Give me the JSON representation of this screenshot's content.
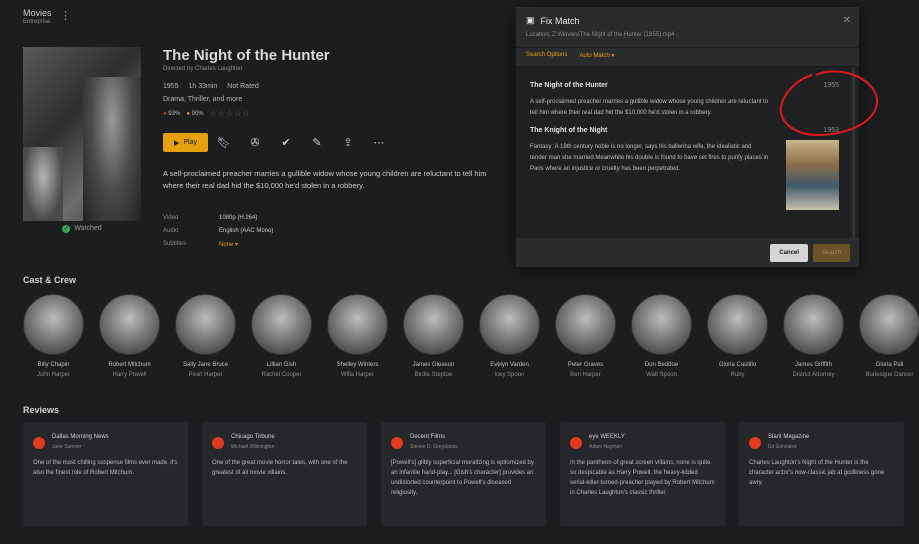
{
  "header": {
    "title": "Movies",
    "subtitle": "Entreprise"
  },
  "movie": {
    "title": "The Night of the Hunter",
    "director": "Directed by Charles Laughton",
    "year": "1955",
    "runtime": "1h 33min",
    "rating": "Not Rated",
    "genres": "Drama, Thriller, and more",
    "critic_score": "93%",
    "audience_score": "90%",
    "play_label": "Play",
    "summary": "A self-proclaimed preacher marries a gullible widow whose young children are reluctant to tell him where their real dad hid the $10,000 he'd stolen in a robbery.",
    "watched_label": "Watched",
    "info": {
      "video_label": "Video",
      "video_value": "1080p (H.264)",
      "audio_label": "Audio",
      "audio_value": "English (AAC Mono)",
      "subtitles_label": "Subtitles",
      "subtitles_value": "None ▾"
    }
  },
  "cast_title": "Cast & Crew",
  "cast": [
    {
      "name": "Billy Chapin",
      "role": "John Harper"
    },
    {
      "name": "Robert Mitchum",
      "role": "Harry Powell"
    },
    {
      "name": "Sally Jane Bruce",
      "role": "Pearl Harper"
    },
    {
      "name": "Lillian Gish",
      "role": "Rachel Cooper"
    },
    {
      "name": "Shelley Winters",
      "role": "Willa Harper"
    },
    {
      "name": "James Gleason",
      "role": "Birdie Steptoe"
    },
    {
      "name": "Evelyn Varden",
      "role": "Icey Spoon"
    },
    {
      "name": "Peter Graves",
      "role": "Ben Harper"
    },
    {
      "name": "Don Beddoe",
      "role": "Walt Spoon"
    },
    {
      "name": "Gloria Castillo",
      "role": "Ruby"
    },
    {
      "name": "James Griffith",
      "role": "District Attorney"
    },
    {
      "name": "Gloria Pall",
      "role": "Burlesque Dancer"
    }
  ],
  "reviews_title": "Reviews",
  "reviews": [
    {
      "source": "Dallas Morning News",
      "author": "Jane Sumner",
      "text": "One of the most chilling suspense films ever made, it's also the finest role of Robert Mitchum."
    },
    {
      "source": "Chicago Tribune",
      "author": "Michael Wilmington",
      "text": "One of the great movie horror tales, with one of the greatest of all movie villains."
    },
    {
      "source": "Decent Films",
      "author": "Steven D. Greydanus",
      "text": "[Powell's] glibly superficial moralizing is epitomized by an infantile hand-play... [Gish's character] provides an undistorted counterpoint to Powell's diseased religiosity."
    },
    {
      "source": "eye WEEKLY",
      "author": "Adam Nayman",
      "text": "In the pantheon of great screen villains, none is quite so despicable as Harry Powell, the heavy-lidded serial-killer-turned-preacher played by Robert Mitchum in Charles Laughton's classic thriller."
    },
    {
      "source": "Slant Magazine",
      "author": "Ed Gonzalez",
      "text": "Charles Laughton's Night of the Hunter is the character actor's now-classic jab at godliness gone awry."
    }
  ],
  "dialog": {
    "title": "Fix Match",
    "location": "Location: Z:\\Movies\\The Night of the Hunter (1955).mp4",
    "tab_options": "Search Options",
    "tab_auto": "Auto Match ▾",
    "results": [
      {
        "title": "The Night of the Hunter",
        "year": "1955",
        "desc": "A self-proclaimed preacher marries a gullible widow whose young children are reluctant to tell him where their real dad hid the $10,000 he'd stolen in a robbery."
      },
      {
        "title": "The Knight of the Night",
        "year": "1953",
        "desc": "Fantasy :A 19th century noble is no longer, says his ballerina wife, the idealistic and tender man she married.Meanwhile his double is found to have set fires to purify places in Paris where an injustice or cruelty has been perpetrated."
      }
    ],
    "cancel_label": "Cancel",
    "search_label": "Search"
  },
  "colors": {
    "accent": "#e5a00d",
    "annotation": "#e0191c"
  }
}
